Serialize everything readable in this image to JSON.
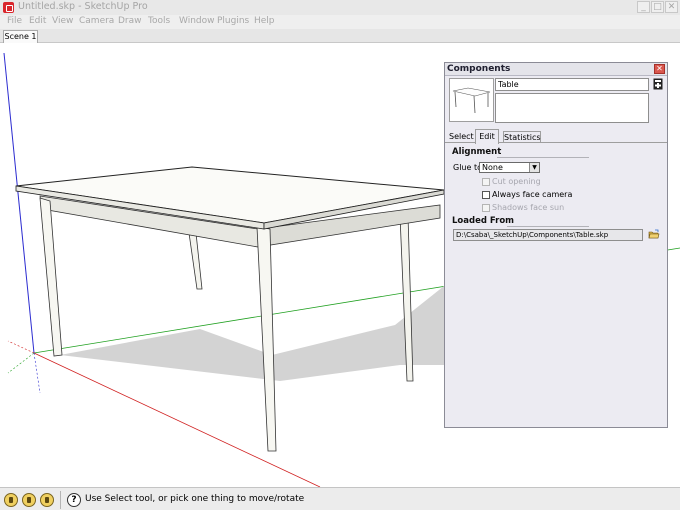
{
  "window": {
    "title": "Untitled.skp - SketchUp Pro",
    "controls": {
      "minimize": "_",
      "maximize": "□",
      "close": "✕"
    }
  },
  "menu": [
    "File",
    "Edit",
    "View",
    "Camera",
    "Draw",
    "Tools",
    "Window",
    "Plugins",
    "Help"
  ],
  "scene_tab": "Scene 1",
  "components_panel": {
    "title": "Components",
    "close": "✕",
    "name_value": "Table",
    "tabs": [
      "Select",
      "Edit",
      "Statistics"
    ],
    "active_tab": "Edit",
    "alignment": {
      "heading": "Alignment",
      "glue_to_label": "Glue to:",
      "glue_to_value": "None",
      "cut_opening": "Cut opening",
      "always_face_camera": "Always face camera",
      "shadows_face_sun": "Shadows face sun"
    },
    "loaded_from": {
      "heading": "Loaded From",
      "path": "D:\\Csaba\\_SketchUp\\Components\\Table.skp"
    }
  },
  "status": {
    "text": "Use Select tool, or pick one thing to move/rotate",
    "help_glyph": "?"
  },
  "icons": {
    "app": "sketchup-logo-icon",
    "add_component": "add-component-icon",
    "folder": "open-folder-icon",
    "status_geolocation": "geolocation-icon",
    "status_credits": "credits-icon",
    "status_user": "user-icon"
  },
  "colors": {
    "red_axis": "#d02020",
    "green_axis": "#20a020",
    "blue_axis": "#2020c0",
    "annotation_arrow": "#e02020"
  }
}
